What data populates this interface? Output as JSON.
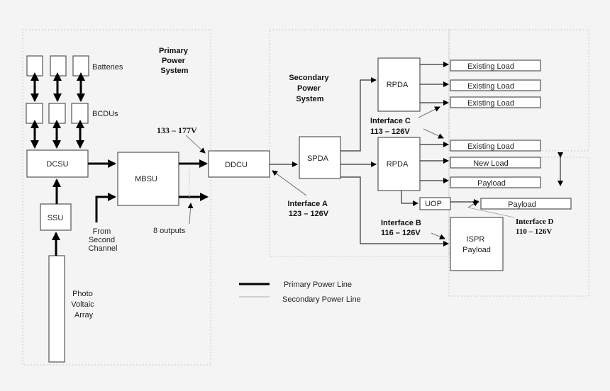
{
  "regions": {
    "primary": {
      "title": [
        "Primary",
        "Power",
        "System"
      ]
    },
    "secondary": {
      "title": [
        "Secondary",
        "Power",
        "System"
      ]
    }
  },
  "blocks": {
    "batteries": "Batteries",
    "bcdus": "BCDUs",
    "dcsu": "DCSU",
    "mbsu": "MBSU",
    "ssu": "SSU",
    "pv_array": [
      "Photo",
      "Voltaic",
      "Array"
    ],
    "ddcu": "DDCU",
    "spda": "SPDA",
    "rpda_top": "RPDA",
    "rpda_bottom": "RPDA",
    "uop": "UOP",
    "ispr": [
      "ISPR",
      "Payload"
    ]
  },
  "loads": [
    "Existing Load",
    "Existing Load",
    "Existing Load",
    "Existing Load",
    "New Load",
    "Payload",
    "Payload"
  ],
  "annotations": {
    "voltage_main": "133 – 177V",
    "from_second": [
      "From",
      "Second",
      "Channel"
    ],
    "outputs": "8 outputs",
    "interface_a": [
      "Interface A",
      "123 – 126V"
    ],
    "interface_b": [
      "Interface B",
      "116 – 126V"
    ],
    "interface_c": [
      "Interface C",
      "113 – 126V"
    ],
    "interface_d": [
      "Interface D",
      "110 – 126V"
    ]
  },
  "legend": {
    "primary": "Primary Power Line",
    "secondary": "Secondary Power Line"
  }
}
